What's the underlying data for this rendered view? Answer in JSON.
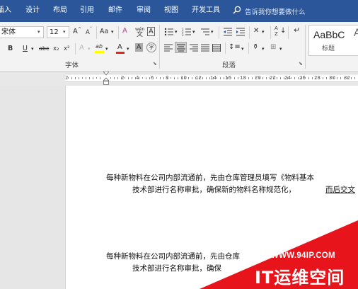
{
  "tabs": [
    {
      "label": "插入"
    },
    {
      "label": "设计"
    },
    {
      "label": "布局"
    },
    {
      "label": "引用"
    },
    {
      "label": "邮件"
    },
    {
      "label": "审阅"
    },
    {
      "label": "视图"
    },
    {
      "label": "开发工具"
    }
  ],
  "tell_me": {
    "placeholder": "告诉我你想要做什么",
    "icon": "lightbulb-search-icon"
  },
  "font_group": {
    "font_name": "宋体",
    "font_size": "12",
    "grow_label": "A",
    "shrink_label": "A",
    "case_label": "Aa",
    "clear_label": "A",
    "phonetic_label": "wén",
    "bold_label": "B",
    "italic_label": "I",
    "underline_label": "U",
    "strike_label": "abc",
    "subscript_label": "x₂",
    "superscript_label": "x²",
    "effects_label": "A",
    "highlight_label": "ab",
    "font_color_label": "A",
    "shading_label": "A",
    "enclose_label": "字",
    "label": "字体"
  },
  "paragraph_group": {
    "label": "段落"
  },
  "styles_group": {
    "sample": "AaBbC",
    "next_sample": "A",
    "style_name": "标题"
  },
  "ruler": {
    "numbers": [
      "2",
      "2",
      "4",
      "6",
      "8",
      "10",
      "12",
      "14",
      "16",
      "18",
      "20",
      "22",
      "24",
      "26",
      "28",
      "30",
      "32",
      "34",
      "36"
    ]
  },
  "document": {
    "para1_line1": "每种新物料在公司内部流通前，先由仓库管理员填写《物料基本",
    "para1_line2": "技术部进行名称审批，确保新的物料名称规范化，",
    "para1_line2_tail": "而后交文",
    "para2_line1": "每种新物料在公司内部流通前，先由仓库",
    "para2_line2": "技术部进行名称审批，确保"
  },
  "watermark": {
    "url": "WWW.94IP.COM",
    "name": "IT运维空间"
  },
  "colors": {
    "accent": "#2b579a",
    "ribbon": "#f3f3f3",
    "font_color_red": "#e0251b",
    "highlight_yellow": "#ffff00",
    "watermark_red": "#e8141c"
  }
}
